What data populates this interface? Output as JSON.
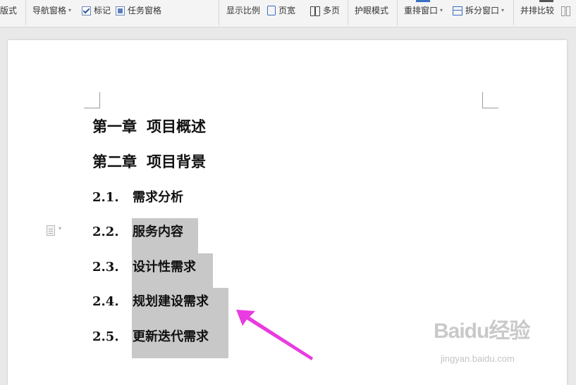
{
  "toolbar": {
    "layout_label": "版式",
    "nav_pane_label": "导航窗格",
    "mark_label": "标记",
    "mark_checked": true,
    "task_pane_label": "任务窗格",
    "task_pane_checked": true,
    "zoom_label": "显示比例",
    "page_width_label": "页宽",
    "multi_page_label": "多页",
    "eye_mode_label": "护眼模式",
    "rearrange_label": "重排窗口",
    "split_label": "拆分窗口",
    "side_by_side_label": "并排比较"
  },
  "document": {
    "chapters": [
      {
        "text": "第一章",
        "title": "项目概述"
      },
      {
        "text": "第二章",
        "title": "项目背景"
      }
    ],
    "sections": [
      {
        "num": "2.1.",
        "title": "需求分析",
        "selected": false
      },
      {
        "num": "2.2.",
        "title": "服务内容",
        "selected": true
      },
      {
        "num": "2.3.",
        "title": "设计性需求",
        "selected": true
      },
      {
        "num": "2.4.",
        "title": "规划建设需求",
        "selected": true
      },
      {
        "num": "2.5.",
        "title": "更新迭代需求",
        "selected": true
      }
    ]
  },
  "annotation": {
    "color": "#e83be0",
    "type": "arrow"
  },
  "watermark": {
    "logo": "Baidu经验",
    "url": "jingyan.baidu.com"
  },
  "colors": {
    "selection": "#c8c8c8",
    "toolbar": "#f4f4f4",
    "canvas": "#e9e9e9"
  }
}
